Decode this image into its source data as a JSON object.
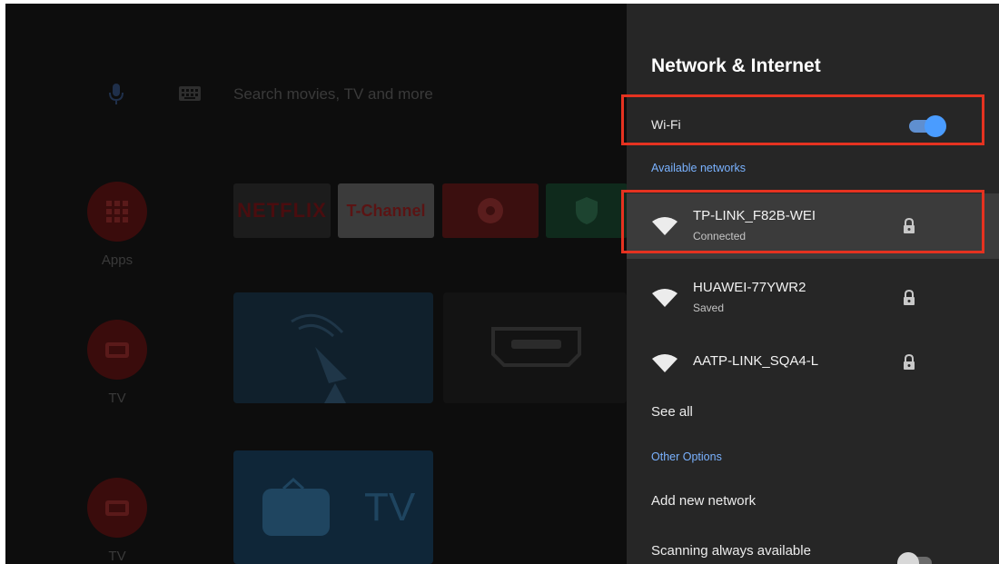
{
  "home": {
    "search_placeholder": "Search movies, TV and more",
    "apps_label": "Apps",
    "tv_label": "TV",
    "tv_label_2": "TV",
    "tiles": {
      "netflix": "NETFLIX",
      "tchannel": "T-Channel"
    },
    "tv_card_word": "TV"
  },
  "panel": {
    "title": "Network & Internet",
    "wifi_label": "Wi-Fi",
    "wifi_enabled": true,
    "available_header": "Available networks",
    "networks": [
      {
        "name": "TP-LINK_F82B-WEI",
        "status": "Connected",
        "icon": "wifi-icon",
        "secured": true
      },
      {
        "name": "HUAWEI-77YWR2",
        "status": "Saved",
        "icon": "wifi-icon",
        "secured": true
      },
      {
        "name": "AATP-LINK_SQA4-L",
        "status": "",
        "icon": "wifi-icon",
        "secured": true
      }
    ],
    "see_all": "See all",
    "other_header": "Other Options",
    "add_network": "Add new network",
    "scanning_label": "Scanning always available",
    "scanning_enabled": false
  },
  "colors": {
    "panel_bg": "#262626",
    "accent_blue": "#4a9cff",
    "highlight_red": "#e53220",
    "selected_row": "#3b3b3b"
  }
}
